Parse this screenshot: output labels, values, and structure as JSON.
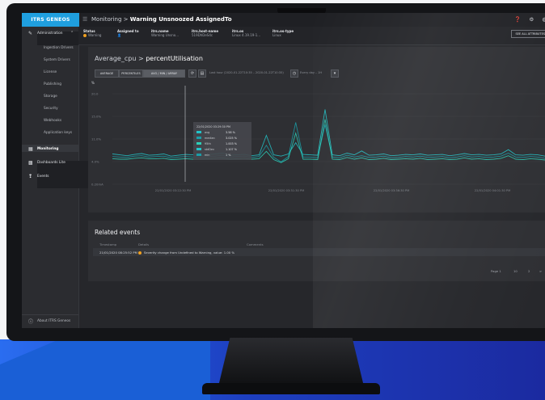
{
  "app": {
    "logo": "ITRS GENEOS",
    "breadcrumb_prefix": "Monitoring",
    "breadcrumb_sep": ">",
    "breadcrumb_current": "Warning Unsnoozed AssignedTo"
  },
  "context": {
    "columns": [
      {
        "header": "Status",
        "value": "Warning"
      },
      {
        "header": "Assigned to",
        "value": ""
      },
      {
        "header": "itrs.name",
        "value": "Warning Unsno..."
      },
      {
        "header": "itrs.host-name",
        "value": "519DhDeS4c"
      },
      {
        "header": "itrs.os",
        "value": "Linux 4.19.19-1..."
      },
      {
        "header": "itrs.os-type",
        "value": "Linux"
      }
    ],
    "see_all": "SEE ALL ATTRIBUTES"
  },
  "sidebar": {
    "section": "Administration",
    "admin_items": [
      "Ingestion Drivers",
      "System Drivers",
      "License",
      "Publishing",
      "Storage",
      "Security",
      "Webhooks",
      "Application keys"
    ],
    "nav": [
      "Monitoring",
      "Dashboards Lite",
      "Events"
    ],
    "about": "About ITRS Geneos"
  },
  "panel": {
    "title_prefix": "Average_cpu",
    "title_sep": ">",
    "title_metric": "percentUtilisation",
    "buttons": [
      "AVERAGE",
      "PERCENTILES",
      "AVG / MIN / ARRAY"
    ],
    "range_text": "Last hour (2020-01-22T10:35 – 2020-01-22T10:35)",
    "interval_text": "Every day – 1H"
  },
  "chart_data": {
    "type": "line",
    "ylabel": "%",
    "y_ticks": [
      "20.0",
      "15.0%",
      "11.0%",
      "4.0%",
      "0.20mA"
    ],
    "x_ticks": [
      "22/01/2020 03:22:30 PM",
      "22/01/2020 03:31:30 PM",
      "22/01/2020 03:36:30 PM",
      "22/01/2020 04:01:30 PM"
    ],
    "tooltip": {
      "title": "22/01/2020 03:29:30 PM",
      "rows": [
        {
          "name": "avg",
          "value": "3.58 %"
        },
        {
          "name": "median",
          "value": "3.025 %"
        },
        {
          "name": "95th",
          "value": "1.003 %"
        },
        {
          "name": "stdDev",
          "value": "1.107 %"
        },
        {
          "name": "min",
          "value": "1 %"
        }
      ]
    },
    "series": [
      {
        "values": [
          4.2,
          4.0,
          3.8,
          4.1,
          4.3,
          3.9,
          4.0,
          4.2,
          3.7,
          3.9,
          4.1,
          4.0,
          3.8,
          4.0,
          4.2,
          4.4,
          3.9,
          4.0,
          4.1,
          3.8,
          4.0,
          8.5,
          4.0,
          3.7,
          4.2,
          6.8,
          4.1,
          4.0,
          3.9,
          14.5,
          4.0,
          3.8,
          4.4,
          4.0,
          4.9,
          3.9,
          4.0,
          4.2,
          3.8,
          3.9,
          4.1,
          4.0,
          4.2,
          3.9,
          4.0,
          4.1,
          3.8,
          4.0,
          4.3,
          4.0,
          4.1,
          3.9,
          4.0,
          4.2,
          5.2,
          4.0,
          3.9,
          4.1,
          4.0,
          3.7
        ]
      },
      {
        "values": [
          3.6,
          3.5,
          3.4,
          3.7,
          3.8,
          3.5,
          3.6,
          3.7,
          3.3,
          3.5,
          3.6,
          3.5,
          3.4,
          3.6,
          3.7,
          3.9,
          3.5,
          3.6,
          3.7,
          3.4,
          3.6,
          6.2,
          3.4,
          2.4,
          3.6,
          11.5,
          3.5,
          3.5,
          3.3,
          11.0,
          3.5,
          3.3,
          3.9,
          3.5,
          3.8,
          3.4,
          3.5,
          3.7,
          3.3,
          3.4,
          3.6,
          3.5,
          3.7,
          3.4,
          3.5,
          3.6,
          3.3,
          3.5,
          3.8,
          3.5,
          3.6,
          3.4,
          3.5,
          3.7,
          4.4,
          3.5,
          3.4,
          3.6,
          3.5,
          3.2
        ]
      },
      {
        "values": [
          3.1,
          3.0,
          3.0,
          3.2,
          3.3,
          3.1,
          3.1,
          3.2,
          2.9,
          3.0,
          3.1,
          3.0,
          3.0,
          3.1,
          3.2,
          3.3,
          3.0,
          3.1,
          3.2,
          3.0,
          3.1,
          4.8,
          2.9,
          2.2,
          3.1,
          9.0,
          3.0,
          3.0,
          2.9,
          12.2,
          3.0,
          2.9,
          3.4,
          3.0,
          3.3,
          2.9,
          3.0,
          3.2,
          2.9,
          3.0,
          3.1,
          3.0,
          3.2,
          2.9,
          3.0,
          3.1,
          2.9,
          3.0,
          3.3,
          3.0,
          3.1,
          2.9,
          3.0,
          3.2,
          3.8,
          3.0,
          2.9,
          3.1,
          3.0,
          2.8
        ]
      }
    ]
  },
  "events": {
    "title": "Related events",
    "headers": [
      "Timestamp",
      "Details",
      "Comments"
    ],
    "row": {
      "timestamp": "21/01/2020 08:25:52 PM",
      "details": "Severity change from Undefined to Warning, value: 1.00 %"
    },
    "pager": {
      "label": "Page 1",
      "of": "10",
      "next": "2",
      "last": ">"
    }
  },
  "colors": {
    "accent": "#1f9fdf",
    "warning": "#f0a020",
    "series": "#1fb3b8"
  }
}
